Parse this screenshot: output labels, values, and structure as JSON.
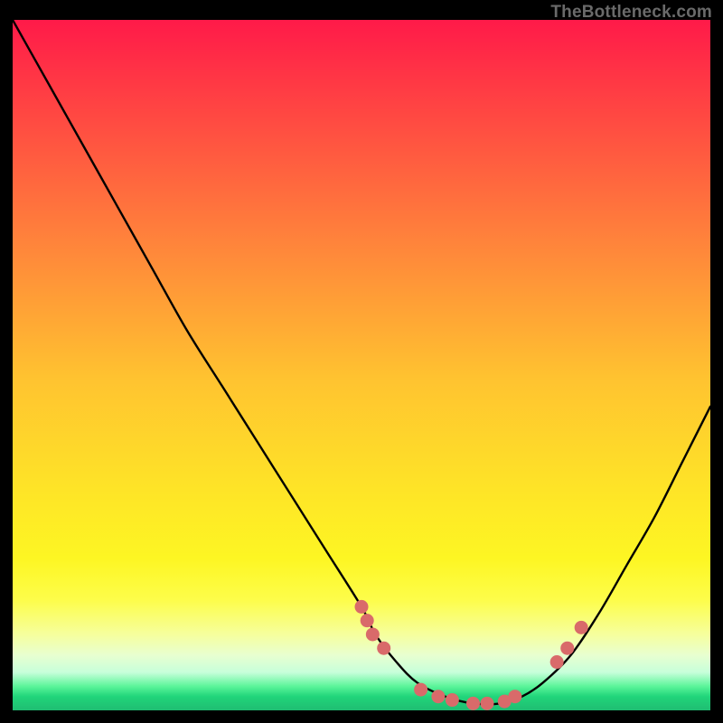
{
  "watermark": "TheBottleneck.com",
  "chart_data": {
    "type": "line",
    "title": "",
    "xlabel": "",
    "ylabel": "",
    "xlim": [
      0,
      100
    ],
    "ylim": [
      0,
      100
    ],
    "series": [
      {
        "name": "bottleneck-curve",
        "x": [
          0,
          5,
          10,
          15,
          20,
          25,
          30,
          35,
          40,
          45,
          50,
          52,
          55,
          58,
          62,
          66,
          70,
          73,
          76,
          80,
          84,
          88,
          92,
          96,
          100
        ],
        "y": [
          100,
          91,
          82,
          73,
          64,
          55,
          47,
          39,
          31,
          23,
          15,
          11,
          7,
          4,
          2,
          1,
          1,
          2,
          4,
          8,
          14,
          21,
          28,
          36,
          44
        ]
      }
    ],
    "markers": {
      "name": "highlight-points",
      "color": "#d96a6a",
      "x": [
        50.0,
        50.8,
        51.6,
        53.2,
        58.5,
        61.0,
        63.0,
        66.0,
        68.0,
        70.5,
        72.0,
        78.0,
        79.5,
        81.5
      ],
      "y": [
        15.0,
        13.0,
        11.0,
        9.0,
        3.0,
        2.0,
        1.5,
        1.0,
        1.0,
        1.3,
        2.0,
        7.0,
        9.0,
        12.0
      ]
    }
  }
}
